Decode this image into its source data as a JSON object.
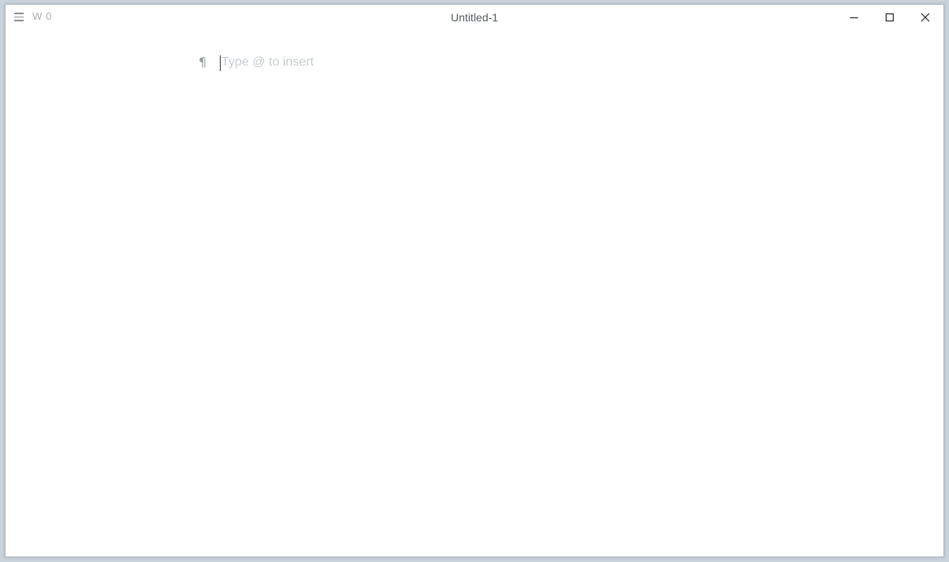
{
  "window": {
    "title": "Untitled-1"
  },
  "toolbar": {
    "menu_icon": "hamburger-icon",
    "word_count": "W 0"
  },
  "window_controls": {
    "minimize_icon": "minimize-icon",
    "maximize_icon": "maximize-icon",
    "close_icon": "close-icon"
  },
  "editor": {
    "paragraph_marker": "¶",
    "placeholder": "Type @ to insert"
  }
}
